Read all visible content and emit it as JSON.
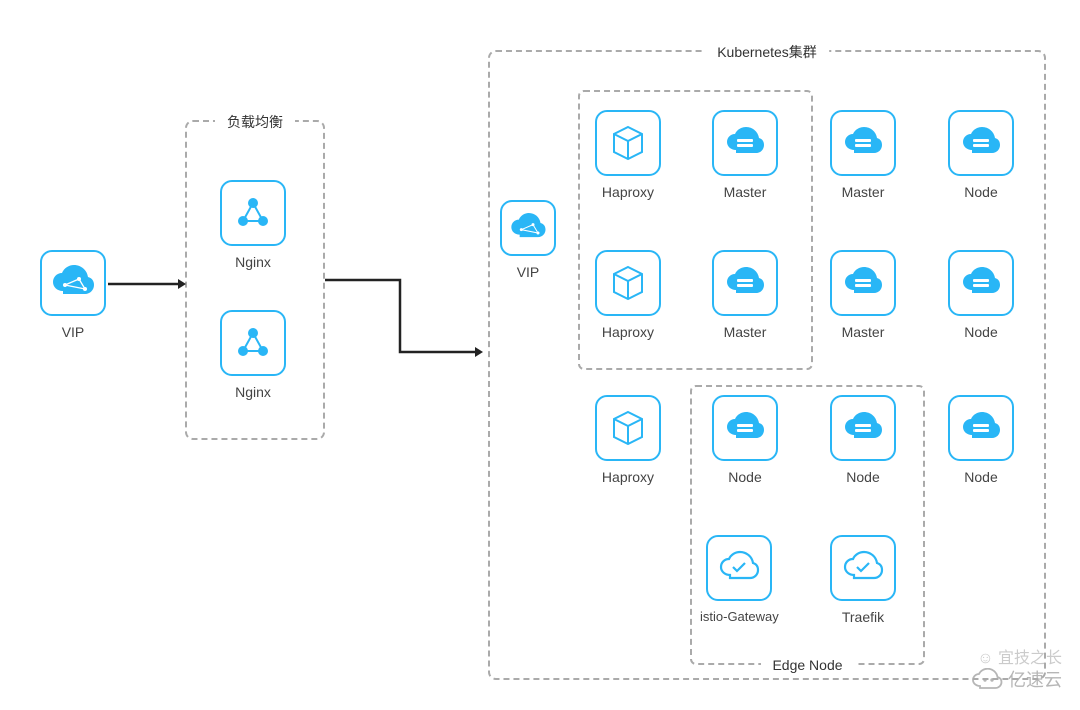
{
  "c": {
    "accent": "#29b6f6",
    "stroke": "#222"
  },
  "left": {
    "vip": "VIP"
  },
  "lb": {
    "title": "负载均衡",
    "n1": "Nginx",
    "n2": "Nginx"
  },
  "kube": {
    "title": "Kubernetes集群",
    "vip": "VIP",
    "ha1": "Haproxy",
    "ha2": "Haproxy",
    "ha3": "Haproxy",
    "m1": "Master",
    "m2": "Master",
    "m3": "Master",
    "m4": "Master",
    "n1": "Node",
    "n2": "Node",
    "n3": "Node",
    "n4": "Node",
    "n5": "Node",
    "edge": {
      "title": "Edge Node",
      "istio": "istio-Gateway",
      "traefik": "Traefik"
    }
  },
  "wm": {
    "cloud": "亿速云",
    "char": "宜技之长"
  }
}
